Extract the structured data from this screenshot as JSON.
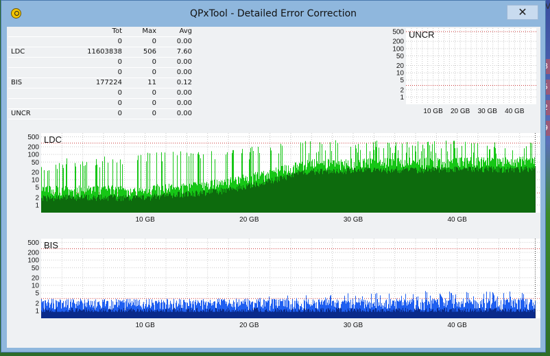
{
  "window": {
    "title": "QPxTool - Detailed Error Correction",
    "close_glyph": "✕"
  },
  "desktop": {
    "partial_texts": [
      "MA",
      "8",
      "5",
      "2",
      "9"
    ]
  },
  "stats": {
    "headers": [
      "",
      "Tot",
      "Max",
      "Avg"
    ],
    "rows": [
      [
        "",
        "0",
        "0",
        "0.00"
      ],
      [
        "LDC",
        "11603838",
        "506",
        "7.60"
      ],
      [
        "",
        "0",
        "0",
        "0.00"
      ],
      [
        "",
        "0",
        "0",
        "0.00"
      ],
      [
        "BIS",
        "177224",
        "11",
        "0.12"
      ],
      [
        "",
        "0",
        "0",
        "0.00"
      ],
      [
        "",
        "0",
        "0",
        "0.00"
      ],
      [
        "UNCR",
        "0",
        "0",
        "0.00"
      ]
    ]
  },
  "chart_data": [
    {
      "type": "area",
      "title": "UNCR",
      "scale": "log",
      "y_ticks": [
        "500",
        "200",
        "100",
        "50",
        "20",
        "10",
        "5",
        "2",
        "1"
      ],
      "x_ticks": [
        "10 GB",
        "20 GB",
        "30 GB",
        "40 GB"
      ],
      "x_values": [
        10,
        20,
        30,
        40
      ],
      "xlim": [
        0,
        48
      ],
      "ylim": [
        0.5,
        700
      ],
      "threshold_lines": [
        500,
        3
      ],
      "series": [
        {
          "values": []
        }
      ],
      "colors": {
        "primary": "#16c616",
        "dark": "#0d6b0d"
      }
    },
    {
      "type": "area",
      "title": "LDC",
      "scale": "log",
      "y_ticks": [
        "500",
        "200",
        "100",
        "50",
        "20",
        "10",
        "5",
        "2",
        "1"
      ],
      "x_ticks": [
        "10 GB",
        "20 GB",
        "30 GB",
        "40 GB"
      ],
      "x_values": [
        10,
        20,
        30,
        40
      ],
      "xlim": [
        0,
        48
      ],
      "ylim": [
        0.5,
        700
      ],
      "end_gb": 47.5,
      "threshold_lines": [
        280,
        3
      ],
      "envelope_gb": [
        0,
        5,
        10,
        15,
        18,
        20,
        22,
        23.8,
        26,
        30,
        35,
        40,
        45,
        47.5
      ],
      "envelope_max": [
        60,
        90,
        120,
        150,
        170,
        200,
        260,
        450,
        350,
        380,
        370,
        360,
        330,
        300
      ],
      "envelope_avg": [
        2,
        2,
        2,
        3,
        4,
        6,
        9,
        14,
        22,
        24,
        25,
        26,
        27,
        28
      ],
      "colors": {
        "primary": "#16c616",
        "dark": "#0d6b0d",
        "threshold": "#cc3333"
      }
    },
    {
      "type": "area",
      "title": "BIS",
      "scale": "log",
      "y_ticks": [
        "500",
        "200",
        "100",
        "50",
        "20",
        "10",
        "5",
        "2",
        "1"
      ],
      "x_ticks": [
        "10 GB",
        "20 GB",
        "30 GB",
        "40 GB"
      ],
      "x_values": [
        10,
        20,
        30,
        40
      ],
      "xlim": [
        0,
        48
      ],
      "ylim": [
        0.5,
        700
      ],
      "end_gb": 47.5,
      "threshold_lines": [
        280,
        3
      ],
      "envelope_gb": [
        0,
        10,
        15,
        18,
        20,
        22,
        24,
        26,
        30,
        35,
        40,
        45,
        47.5
      ],
      "envelope_max": [
        2,
        2,
        3,
        3,
        3,
        4,
        4,
        5,
        5,
        6,
        6,
        6,
        6
      ],
      "envelope_avg": [
        1,
        1,
        1,
        1,
        1,
        1,
        1,
        1,
        1,
        1,
        1,
        1,
        1
      ],
      "colors": {
        "primary": "#1f5ff0",
        "dark": "#0a2a8a",
        "threshold": "#cc3333"
      }
    }
  ]
}
